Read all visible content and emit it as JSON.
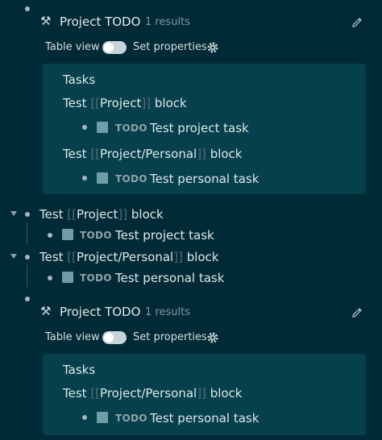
{
  "queries": [
    {
      "title": "Project TODO",
      "results": "1 results",
      "table_view_label": "Table view",
      "set_properties_label": "Set properties",
      "panel_heading": "Tasks"
    },
    {
      "title": "Project TODO",
      "results": "1 results",
      "table_view_label": "Table view",
      "set_properties_label": "Set properties",
      "panel_heading": "Tasks"
    }
  ],
  "blocks": {
    "project": {
      "prefix": "Test",
      "page": "Project",
      "suffix": "block"
    },
    "personal": {
      "prefix": "Test",
      "page": "Project/Personal",
      "suffix": "block"
    }
  },
  "tasks": {
    "project": {
      "marker": "TODO",
      "text": "Test project task"
    },
    "personal": {
      "marker": "TODO",
      "text": "Test personal task"
    }
  },
  "brackets": {
    "open": "[[",
    "close": "]]"
  },
  "colors": {
    "background": "#002b36",
    "panel": "#05404c",
    "checkbox": "#6f9ea6"
  },
  "icons": {
    "hammer": "hammer-icon",
    "pencil": "pencil-icon",
    "gear": "gear-icon",
    "caret": "caret-down-icon"
  }
}
